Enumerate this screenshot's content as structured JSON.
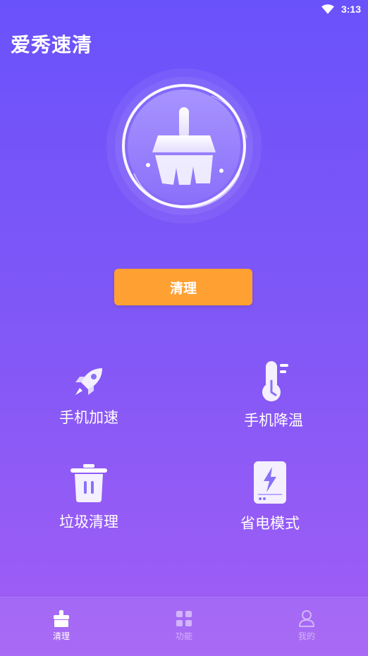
{
  "status_bar": {
    "time": "3:13",
    "icons": [
      "wifi-icon"
    ]
  },
  "app": {
    "title": "爱秀速清"
  },
  "hero": {
    "icon": "broom-icon"
  },
  "main": {
    "clean_button_label": "清理"
  },
  "features": [
    {
      "label": "手机加速",
      "icon": "rocket-icon"
    },
    {
      "label": "手机降温",
      "icon": "thermometer-icon"
    },
    {
      "label": "垃圾清理",
      "icon": "trash-icon"
    },
    {
      "label": "省电模式",
      "icon": "battery-saver-icon"
    }
  ],
  "bottom_nav": {
    "items": [
      {
        "label": "清理",
        "icon": "broom-nav-icon",
        "active": true
      },
      {
        "label": "功能",
        "icon": "grid-icon",
        "active": false
      },
      {
        "label": "我的",
        "icon": "user-icon",
        "active": false
      }
    ]
  },
  "colors": {
    "accent": "#ffa033",
    "bg_top": "#6a52fb",
    "bg_bottom": "#a25ef5"
  }
}
